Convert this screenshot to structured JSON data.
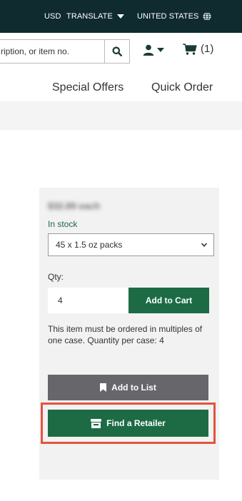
{
  "header": {
    "currency": "USD",
    "translate_label": "TRANSLATE",
    "country": "UNITED STATES",
    "icons": [
      "caret-down-icon",
      "globe-icon"
    ]
  },
  "search": {
    "placeholder_visible": "ription, or item no.",
    "button_icon": "search-icon"
  },
  "account": {
    "user_icon": "user-icon",
    "cart_icon": "cart-icon",
    "cart_count": "(1)"
  },
  "nav": {
    "special_offers": "Special Offers",
    "quick_order": "Quick Order"
  },
  "product": {
    "price": "$32.89 each",
    "stock_status": "In stock",
    "pack_option": "45 x 1.5 oz packs",
    "qty_label": "Qty:",
    "qty_value": "4",
    "add_to_cart": "Add to Cart",
    "multiples_note": "This item must be ordered in multiples of one case. Quantity per case: 4",
    "add_to_list": "Add to List",
    "find_retailer": "Find a Retailer"
  },
  "colors": {
    "topbar_bg": "#0f2b30",
    "primary_green": "#1c6b45",
    "list_button_grey": "#67676b",
    "highlight_border": "#e4533d",
    "stock_green": "#1a6b45"
  }
}
